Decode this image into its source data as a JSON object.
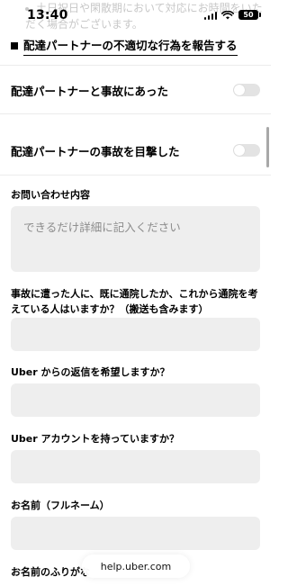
{
  "status_bar": {
    "time": "13:40",
    "battery": "50"
  },
  "background_text": [
    "土日祝日や閑散期において対応にお時間をいただく場合がございます。",
    "時間をいただく場合がございます。"
  ],
  "section_header": "配達パートナーの不適切な行為を報告する",
  "toggles": [
    {
      "label": "配達パートナーと事故にあった",
      "on": false
    },
    {
      "label": "配達パートナーの事故を目撃した",
      "on": false
    }
  ],
  "form": {
    "inquiry_label": "お問い合わせ内容",
    "inquiry_placeholder": "できるだけ詳細に記入ください",
    "hospital_label": "事故に遭った人に、既に通院したか、これから通院を考えている人はいますか？（搬送も含みます）",
    "reply_label": "Uber からの返信を希望しますか？",
    "account_label": "Uber アカウントを持っていますか？",
    "full_name_label": "お名前（フルネーム）",
    "furigana_label": "お名前のふりがな"
  },
  "browser": {
    "url": "help.uber.com"
  }
}
